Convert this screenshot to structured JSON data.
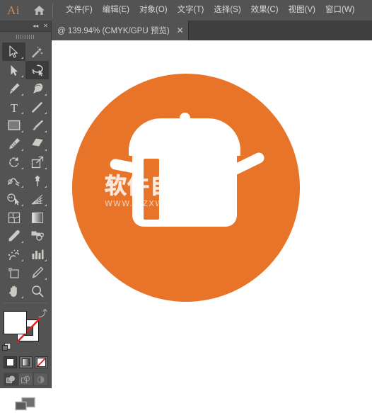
{
  "app": {
    "logo_text": "Ai",
    "home_icon": "home-icon"
  },
  "menubar": {
    "items": [
      {
        "label": "文件(F)",
        "name": "menu-file"
      },
      {
        "label": "编辑(E)",
        "name": "menu-edit"
      },
      {
        "label": "对象(O)",
        "name": "menu-object"
      },
      {
        "label": "文字(T)",
        "name": "menu-type"
      },
      {
        "label": "选择(S)",
        "name": "menu-select"
      },
      {
        "label": "效果(C)",
        "name": "menu-effect"
      },
      {
        "label": "视图(V)",
        "name": "menu-view"
      },
      {
        "label": "窗口(W)",
        "name": "menu-window"
      }
    ]
  },
  "tabbar": {
    "document_tab": {
      "label": "@ 139.94% (CMYK/GPU 预览)",
      "zoom": "139.94%",
      "color_mode": "CMYK",
      "render_mode": "GPU 预览",
      "close_label": "✕"
    }
  },
  "toolpanel": {
    "collapse_label": "◂◂",
    "close_label": "✕",
    "tools": [
      {
        "name": "selection-tool",
        "label": "选择工具",
        "active": true,
        "has_flyout": true
      },
      {
        "name": "magic-wand-tool",
        "label": "魔棒工具",
        "active": false,
        "has_flyout": false
      },
      {
        "name": "direct-selection-tool",
        "label": "直接选择工具",
        "active": false,
        "has_flyout": true
      },
      {
        "name": "lasso-tool",
        "label": "套索工具",
        "active": true,
        "has_flyout": false
      },
      {
        "name": "pen-tool",
        "label": "钢笔工具",
        "active": false,
        "has_flyout": true
      },
      {
        "name": "curvature-tool",
        "label": "曲率工具",
        "active": false,
        "has_flyout": true
      },
      {
        "name": "type-tool",
        "label": "文字工具",
        "active": false,
        "has_flyout": true
      },
      {
        "name": "line-segment-tool",
        "label": "直线段工具",
        "active": false,
        "has_flyout": true
      },
      {
        "name": "rectangle-tool",
        "label": "矩形工具",
        "active": false,
        "has_flyout": true
      },
      {
        "name": "paintbrush-tool",
        "label": "画笔工具",
        "active": false,
        "has_flyout": true
      },
      {
        "name": "shaper-tool",
        "label": "Shaper 工具",
        "active": false,
        "has_flyout": true
      },
      {
        "name": "eraser-tool",
        "label": "橡皮擦工具",
        "active": false,
        "has_flyout": true
      },
      {
        "name": "rotate-tool",
        "label": "旋转工具",
        "active": false,
        "has_flyout": true
      },
      {
        "name": "scale-tool",
        "label": "比例缩放工具",
        "active": false,
        "has_flyout": true
      },
      {
        "name": "width-tool",
        "label": "宽度工具",
        "active": false,
        "has_flyout": true
      },
      {
        "name": "free-transform-tool",
        "label": "自由变换工具",
        "active": false,
        "has_flyout": true
      },
      {
        "name": "shape-builder-tool",
        "label": "形状生成器工具",
        "active": false,
        "has_flyout": true
      },
      {
        "name": "perspective-grid-tool",
        "label": "透视网格工具",
        "active": false,
        "has_flyout": true
      },
      {
        "name": "mesh-tool",
        "label": "网格工具",
        "active": false,
        "has_flyout": false
      },
      {
        "name": "gradient-tool",
        "label": "渐变工具",
        "active": false,
        "has_flyout": false
      },
      {
        "name": "eyedropper-tool",
        "label": "吸管工具",
        "active": false,
        "has_flyout": true
      },
      {
        "name": "blend-tool",
        "label": "混合工具",
        "active": false,
        "has_flyout": false
      },
      {
        "name": "symbol-sprayer-tool",
        "label": "符号喷枪工具",
        "active": false,
        "has_flyout": true
      },
      {
        "name": "column-graph-tool",
        "label": "柱形图工具",
        "active": false,
        "has_flyout": true
      },
      {
        "name": "artboard-tool",
        "label": "画板工具",
        "active": false,
        "has_flyout": false
      },
      {
        "name": "slice-tool",
        "label": "切片工具",
        "active": false,
        "has_flyout": true
      },
      {
        "name": "hand-tool",
        "label": "抓手工具",
        "active": false,
        "has_flyout": true
      },
      {
        "name": "zoom-tool",
        "label": "缩放工具",
        "active": false,
        "has_flyout": false
      }
    ],
    "fill_stroke": {
      "fill_color": "#ffffff",
      "stroke_color": "none",
      "swap_label": "⤴",
      "swap_name": "swap-fill-stroke-icon",
      "default_name": "default-fill-stroke-icon"
    },
    "color_modes": [
      {
        "name": "color-mode-button",
        "label": "颜色",
        "active": true
      },
      {
        "name": "gradient-mode-button",
        "label": "渐变",
        "active": false
      },
      {
        "name": "none-mode-button",
        "label": "无",
        "active": false
      }
    ],
    "draw_modes": [
      {
        "name": "draw-normal-button",
        "label": "正常绘图",
        "active": true
      },
      {
        "name": "draw-behind-button",
        "label": "背面绘图",
        "active": false
      },
      {
        "name": "draw-inside-button",
        "label": "内部绘图",
        "active": false
      }
    ],
    "screen_mode": {
      "name": "screen-mode-button",
      "label": "更改屏幕模式"
    }
  },
  "canvas": {
    "artwork": {
      "name": "cooking-pot-illustration",
      "circle_color": "#e8742a",
      "pot_color": "#ffffff",
      "parts": [
        "circle",
        "lid",
        "knob",
        "rim",
        "body",
        "notch",
        "left-handle",
        "right-handle"
      ]
    },
    "watermark": {
      "chinese": "软件自学网",
      "url": "WWW.RJZXW.COM"
    }
  }
}
